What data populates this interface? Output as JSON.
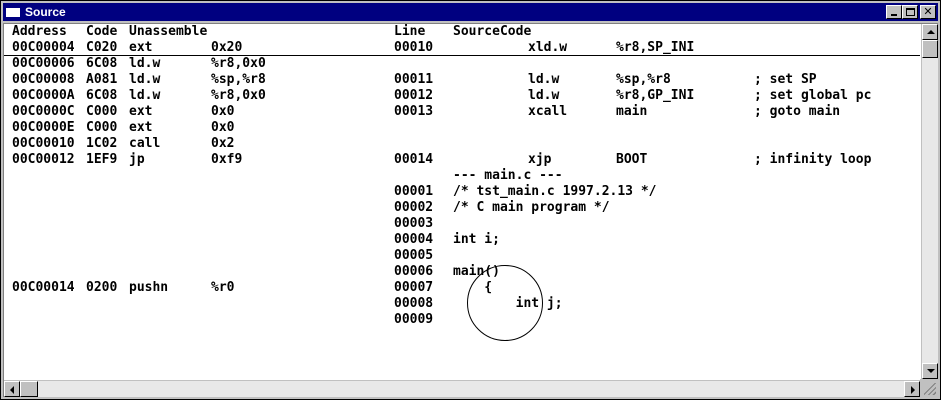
{
  "window": {
    "title": "Source",
    "colors": {
      "titlebar": "#000080",
      "chrome": "#c0c0c0",
      "background": "#ffffff"
    }
  },
  "header": {
    "address": "Address",
    "code": "Code",
    "unassemble": "Unassemble",
    "line": "Line",
    "source_code": "SourceCode"
  },
  "rows": [
    {
      "addr": "00C00004",
      "code": "C020",
      "mnem": "ext",
      "op": "0x20",
      "line": "00010",
      "src": "",
      "asm_mn": "xld.w",
      "asm_op": "%r8,SP_INI",
      "comment": ""
    },
    {
      "addr": "00C00006",
      "code": "6C08",
      "mnem": "ld.w",
      "op": "%r8,0x0",
      "line": "",
      "src": "",
      "asm_mn": "",
      "asm_op": "",
      "comment": ""
    },
    {
      "addr": "00C00008",
      "code": "A081",
      "mnem": "ld.w",
      "op": "%sp,%r8",
      "line": "00011",
      "src": "",
      "asm_mn": "ld.w",
      "asm_op": "%sp,%r8",
      "comment": "; set SP"
    },
    {
      "addr": "00C0000A",
      "code": "6C08",
      "mnem": "ld.w",
      "op": "%r8,0x0",
      "line": "00012",
      "src": "",
      "asm_mn": "ld.w",
      "asm_op": "%r8,GP_INI",
      "comment": "; set global pc"
    },
    {
      "addr": "00C0000C",
      "code": "C000",
      "mnem": "ext",
      "op": "0x0",
      "line": "00013",
      "src": "",
      "asm_mn": "xcall",
      "asm_op": "main",
      "comment": "; goto main"
    },
    {
      "addr": "00C0000E",
      "code": "C000",
      "mnem": "ext",
      "op": "0x0",
      "line": "",
      "src": "",
      "asm_mn": "",
      "asm_op": "",
      "comment": ""
    },
    {
      "addr": "00C00010",
      "code": "1C02",
      "mnem": "call",
      "op": "0x2",
      "line": "",
      "src": "",
      "asm_mn": "",
      "asm_op": "",
      "comment": ""
    },
    {
      "addr": "00C00012",
      "code": "1EF9",
      "mnem": "jp",
      "op": "0xf9",
      "line": "00014",
      "src": "",
      "asm_mn": "xjp",
      "asm_op": "BOOT",
      "comment": "; infinity loop"
    },
    {
      "addr": "",
      "code": "",
      "mnem": "",
      "op": "",
      "line": "",
      "src": "--- main.c ---",
      "asm_mn": "",
      "asm_op": "",
      "comment": ""
    },
    {
      "addr": "",
      "code": "",
      "mnem": "",
      "op": "",
      "line": "00001",
      "src": "/* tst_main.c 1997.2.13 */",
      "asm_mn": "",
      "asm_op": "",
      "comment": ""
    },
    {
      "addr": "",
      "code": "",
      "mnem": "",
      "op": "",
      "line": "00002",
      "src": "/* C main program */",
      "asm_mn": "",
      "asm_op": "",
      "comment": ""
    },
    {
      "addr": "",
      "code": "",
      "mnem": "",
      "op": "",
      "line": "00003",
      "src": "",
      "asm_mn": "",
      "asm_op": "",
      "comment": ""
    },
    {
      "addr": "",
      "code": "",
      "mnem": "",
      "op": "",
      "line": "00004",
      "src": "int i;",
      "asm_mn": "",
      "asm_op": "",
      "comment": ""
    },
    {
      "addr": "",
      "code": "",
      "mnem": "",
      "op": "",
      "line": "00005",
      "src": "",
      "asm_mn": "",
      "asm_op": "",
      "comment": ""
    },
    {
      "addr": "",
      "code": "",
      "mnem": "",
      "op": "",
      "line": "00006",
      "src": "main()",
      "asm_mn": "",
      "asm_op": "",
      "comment": ""
    },
    {
      "addr": "00C00014",
      "code": "0200",
      "mnem": "pushn",
      "op": "%r0",
      "line": "00007",
      "src": "    {",
      "asm_mn": "",
      "asm_op": "",
      "comment": ""
    },
    {
      "addr": "",
      "code": "",
      "mnem": "",
      "op": "",
      "line": "00008",
      "src": "        int j;",
      "asm_mn": "",
      "asm_op": "",
      "comment": ""
    },
    {
      "addr": "",
      "code": "",
      "mnem": "",
      "op": "",
      "line": "00009",
      "src": "",
      "asm_mn": "",
      "asm_op": "",
      "comment": ""
    }
  ],
  "icons": {
    "window": "window-icon",
    "minimize": "minimize-icon",
    "maximize": "maximize-icon",
    "close": "close-icon",
    "scroll_up": "arrow-up-icon",
    "scroll_down": "arrow-down-icon",
    "scroll_left": "arrow-left-icon",
    "scroll_right": "arrow-right-icon",
    "size_grip": "size-grip-icon"
  }
}
